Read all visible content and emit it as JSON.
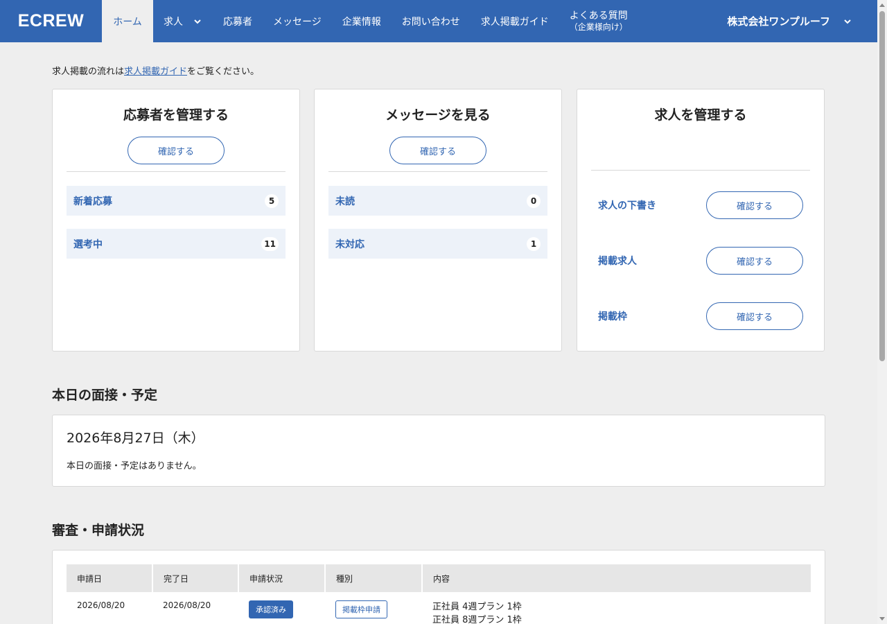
{
  "header": {
    "logo": "ECREW",
    "nav": [
      {
        "label": "ホーム"
      },
      {
        "label": "求人"
      },
      {
        "label": "応募者"
      },
      {
        "label": "メッセージ"
      },
      {
        "label": "企業情報"
      },
      {
        "label": "お問い合わせ"
      },
      {
        "label": "求人掲載ガイド"
      },
      {
        "label": "よくある質問",
        "sub": "（企業様向け）"
      }
    ],
    "company": "株式会社ワンプルーフ"
  },
  "intro": {
    "prefix": "求人掲載の流れは",
    "link": "求人掲載ガイド",
    "suffix": "をご覧ください。"
  },
  "cards": {
    "applicants": {
      "title": "応募者を管理する",
      "button": "確認する",
      "rows": [
        {
          "label": "新着応募",
          "count": "5"
        },
        {
          "label": "選考中",
          "count": "11"
        }
      ]
    },
    "messages": {
      "title": "メッセージを見る",
      "button": "確認する",
      "rows": [
        {
          "label": "未読",
          "count": "0"
        },
        {
          "label": "未対応",
          "count": "1"
        }
      ]
    },
    "jobs": {
      "title": "求人を管理する",
      "rows": [
        {
          "label": "求人の下書き",
          "button": "確認する"
        },
        {
          "label": "掲載求人",
          "button": "確認する"
        },
        {
          "label": "掲載枠",
          "button": "確認する"
        }
      ]
    }
  },
  "schedule": {
    "title": "本日の面接・予定",
    "date": "2026年8月27日（木）",
    "empty": "本日の面接・予定はありません。"
  },
  "review": {
    "title": "審査・申請状況",
    "headers": [
      "申請日",
      "完了日",
      "申請状況",
      "種別",
      "内容"
    ],
    "rows": [
      {
        "applied": "2026/08/20",
        "completed": "2026/08/20",
        "status": "承認済み",
        "type": "掲載枠申請",
        "content": [
          "正社員 4週プラン 1枠",
          "正社員 8週プラン 1枠"
        ]
      }
    ]
  },
  "colors": {
    "primary": "#3266b2",
    "background": "#eeeeee",
    "row_highlight": "#edf2f9"
  }
}
